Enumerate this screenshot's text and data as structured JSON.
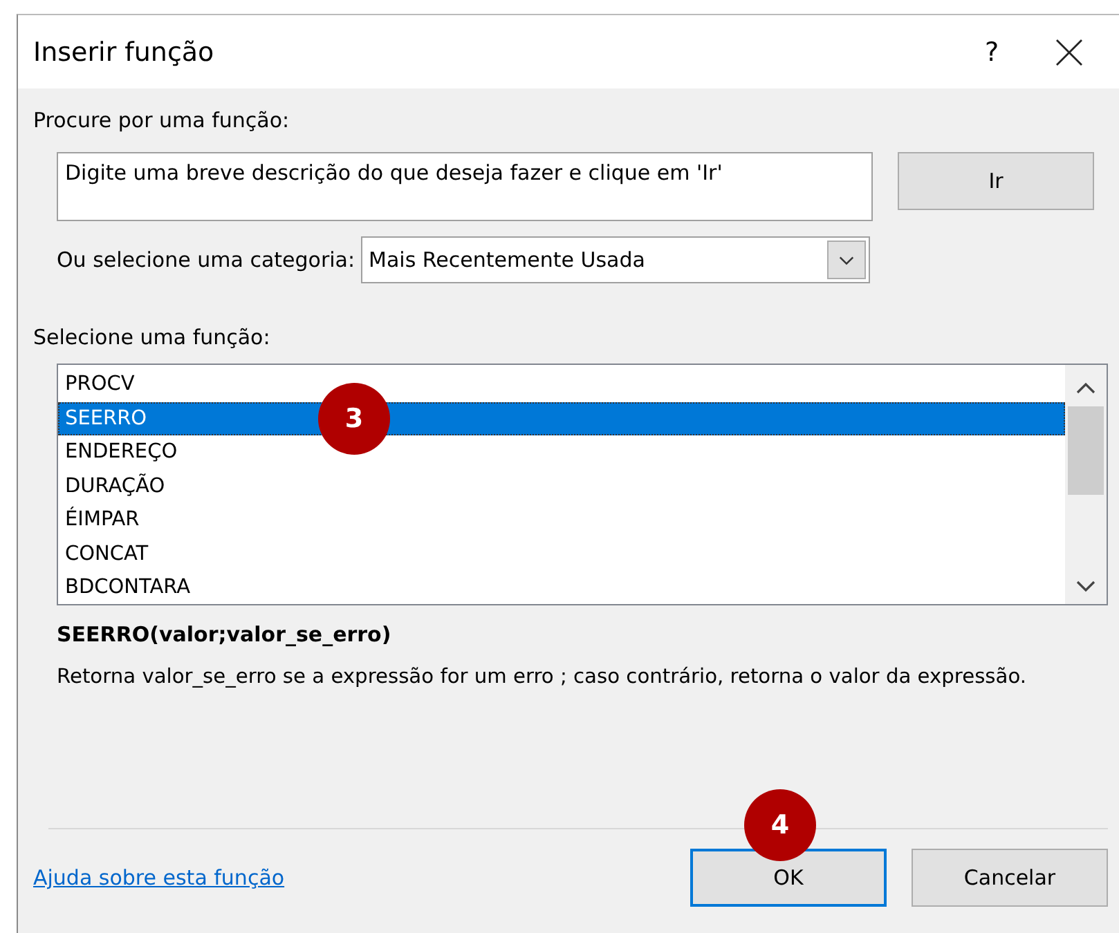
{
  "window": {
    "title": "Inserir função",
    "help": "?"
  },
  "search": {
    "label": "Procure por uma função:",
    "value": "Digite uma breve descrição do que deseja fazer e clique em 'Ir'",
    "button": "Ir"
  },
  "category": {
    "label": "Ou selecione uma categoria:",
    "value": "Mais Recentemente Usada"
  },
  "function_list": {
    "label": "Selecione uma função:",
    "items": [
      {
        "label": "PROCV",
        "selected": false
      },
      {
        "label": "SEERRO",
        "selected": true
      },
      {
        "label": "ENDEREÇO",
        "selected": false
      },
      {
        "label": "DURAÇÃO",
        "selected": false
      },
      {
        "label": "ÉIMPAR",
        "selected": false
      },
      {
        "label": "CONCAT",
        "selected": false
      },
      {
        "label": "BDCONTARA",
        "selected": false
      }
    ]
  },
  "signature": "SEERRO(valor;valor_se_erro)",
  "description": "Retorna valor_se_erro se a expressão for um erro ; caso contrário, retorna o valor da expressão.",
  "help_link": "Ajuda sobre esta função",
  "buttons": [
    {
      "label": "OK",
      "default": true
    },
    {
      "label": "Cancelar",
      "default": false
    }
  ],
  "callouts": [
    {
      "label": "3"
    },
    {
      "label": "4"
    }
  ]
}
